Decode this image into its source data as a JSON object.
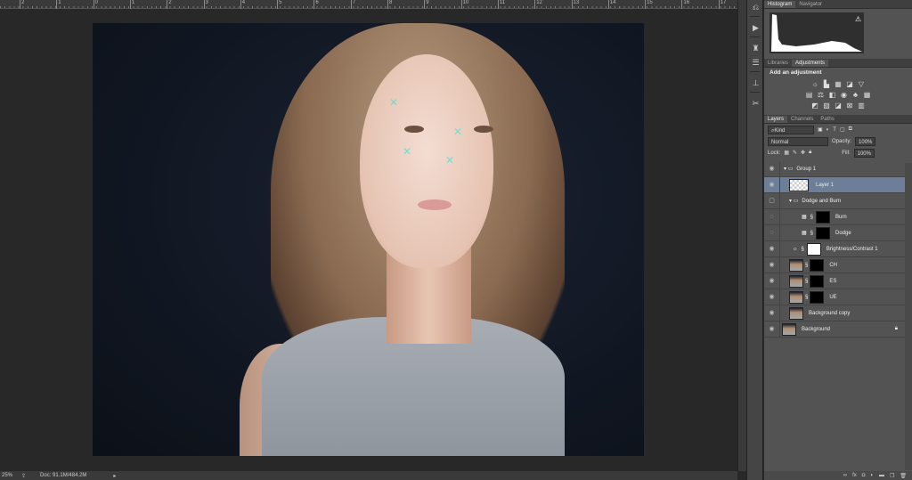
{
  "ruler": {
    "ticks": [
      "2",
      "1",
      "0",
      "1",
      "2",
      "3",
      "4",
      "5",
      "6",
      "7",
      "8",
      "9",
      "10",
      "11",
      "12",
      "13",
      "14",
      "15",
      "16",
      "17"
    ]
  },
  "status": {
    "zoom": "25%",
    "doc": "Doc: 91.1M/484.2M"
  },
  "panels": {
    "top_tabs": [
      "Histogram",
      "Navigator"
    ],
    "adj_tabs": [
      "Libraries",
      "Adjustments"
    ],
    "adj_title": "Add an adjustment",
    "layer_tabs": [
      "Layers",
      "Channels",
      "Paths"
    ],
    "filter": "Kind",
    "blend": "Normal",
    "opacity_label": "Opacity:",
    "opacity": "100%",
    "lock_label": "Lock:",
    "fill_label": "Fill:",
    "fill": "100%"
  },
  "layers": [
    {
      "name": "Group 1"
    },
    {
      "name": "Layer 1"
    },
    {
      "name": "Dodge and Burn"
    },
    {
      "name": "Burn"
    },
    {
      "name": "Dodge"
    },
    {
      "name": "Brightness/Contrast 1"
    },
    {
      "name": "CH"
    },
    {
      "name": "ES"
    },
    {
      "name": "UE"
    },
    {
      "name": "Background copy"
    },
    {
      "name": "Background"
    }
  ]
}
